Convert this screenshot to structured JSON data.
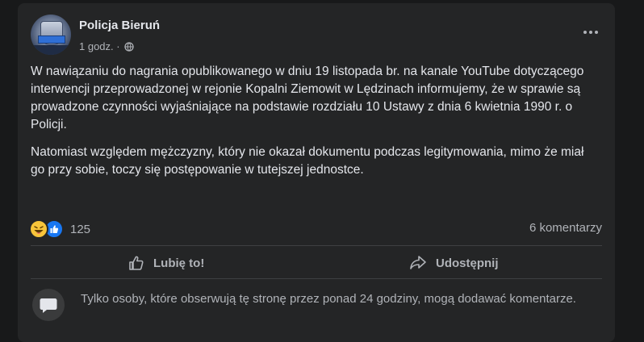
{
  "post": {
    "author": "Policja Bieruń",
    "time": "1 godz. ·",
    "paragraphs": [
      "W nawiązaniu do nagrania opublikowanego w dniu 19 listopada br. na kanale YouTube dotyczącego interwencji przeprowadzonej w rejonie Kopalni Ziemowit w Lędzinach informujemy, że w sprawie są prowadzone czynności wyjaśniające na podstawie rozdziału 10 Ustawy z dnia 6 kwietnia 1990 r. o Policji.",
      "Natomiast względem mężczyzny, który nie okazał dokumentu podczas legitymowania, mimo że miał go przy sobie, toczy się postępowanie w tutejszej jednostce."
    ],
    "reactions": {
      "icons": [
        "haha-icon",
        "like-icon"
      ],
      "count": "125"
    },
    "comments_count": "6 komentarzy"
  },
  "actions": {
    "like_label": "Lubię to!",
    "share_label": "Udostępnij"
  },
  "notice": {
    "text": "Tylko osoby, które obserwują tę stronę przez ponad 24 godziny, mogą dodawać komentarze."
  },
  "colors": {
    "background": "#18191a",
    "card": "#242526",
    "text_primary": "#e4e6eb",
    "text_secondary": "#b0b3b8",
    "like_blue": "#1877f2",
    "haha_yellow": "#f7c43a"
  }
}
